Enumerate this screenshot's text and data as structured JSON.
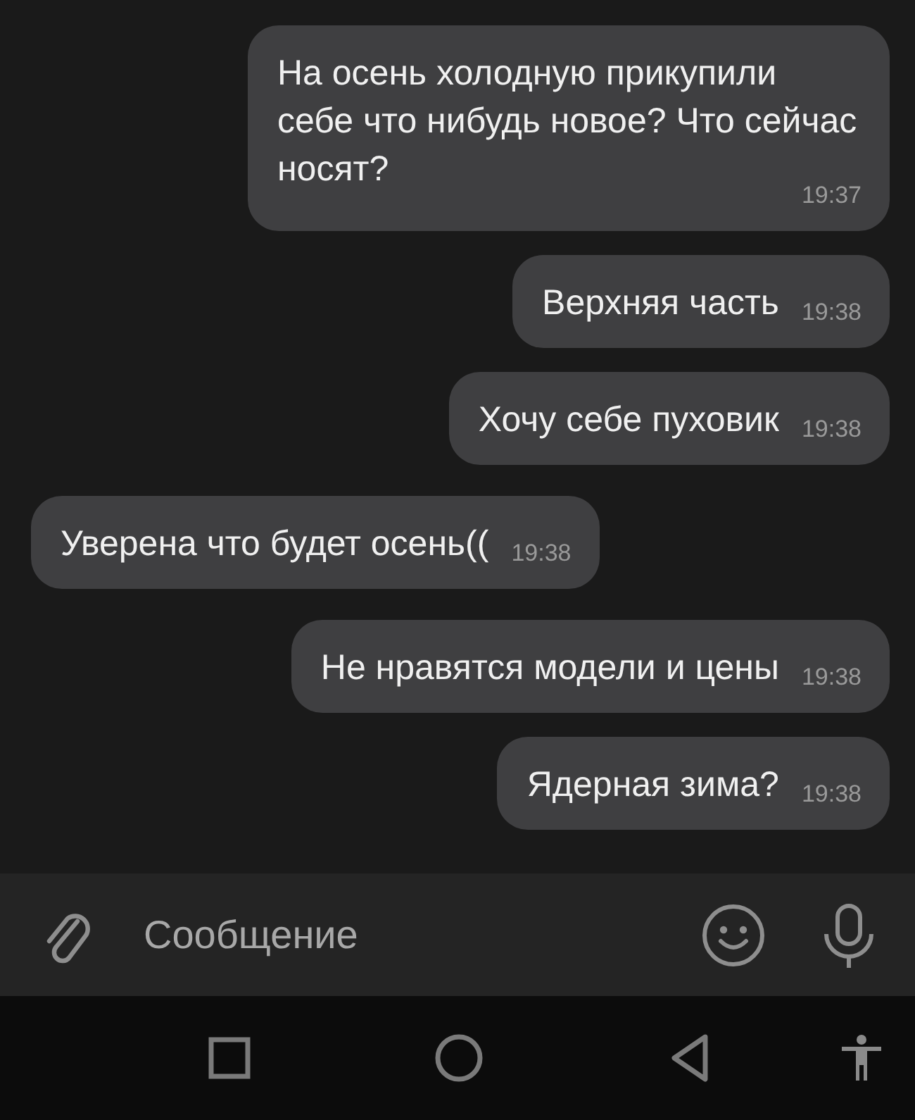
{
  "messages": [
    {
      "kind": "out",
      "text": "На осень холодную прикупили себе что нибудь новое? Что сейчас носят?",
      "time": "19:37"
    },
    {
      "kind": "out",
      "text": "Верхняя часть",
      "time": "19:38"
    },
    {
      "kind": "out",
      "text": "Хочу себе пуховик",
      "time": "19:38"
    },
    {
      "kind": "in",
      "text": "Уверена что будет осень((",
      "time": "19:38"
    },
    {
      "kind": "out",
      "text": "Не нравятся модели и цены",
      "time": "19:38"
    },
    {
      "kind": "out",
      "text": "Ядерная зима?",
      "time": "19:38"
    }
  ],
  "composer": {
    "placeholder": "Сообщение"
  }
}
